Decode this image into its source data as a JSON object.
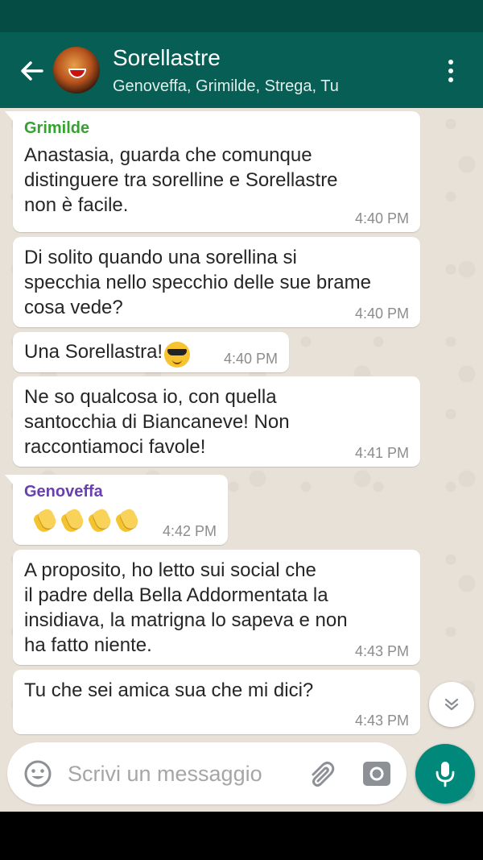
{
  "header": {
    "title": "Sorellastre",
    "subtitle": "Genoveffa, Grimilde, Strega, Tu"
  },
  "messages": [
    {
      "sender": "Grimilde",
      "text": "Anastasia, guarda che comunque\ndistinguere tra sorelline e Sorellastre\nnon è facile.",
      "time": "4:40 PM"
    },
    {
      "text": "Di solito quando una sorellina si\nspecchia nello specchio delle sue brame\ncosa vede?",
      "time": "4:40 PM"
    },
    {
      "text": "Una Sorellastra!",
      "emoji": "smiling-face-with-sunglasses-icon",
      "time": "4:40 PM"
    },
    {
      "text": "Ne so qualcosa io, con quella\nsantocchia di Biancaneve! Non\nraccontiamoci favole!",
      "time": "4:41 PM"
    },
    {
      "sender": "Genoveffa",
      "emoji": "clapping-hands-icon",
      "emoji_count": 4,
      "time": "4:42 PM"
    },
    {
      "text": "A proposito, ho letto sui social che\nil padre della Bella Addormentata la\ninsidiava, la matrigna lo sapeva e non\nha fatto niente.",
      "time": "4:43 PM"
    },
    {
      "text": "Tu che sei amica sua che mi dici?",
      "time": "4:43 PM"
    }
  ],
  "sender_colors": {
    "Grimilde": "#35a12f",
    "Genoveffa": "#6a3fb0"
  },
  "composer": {
    "placeholder": "Scrivi un messaggio"
  },
  "colors": {
    "app_bar": "#075e54",
    "status_bar": "#054d44",
    "accent": "#00897b",
    "chat_background": "#e8e1d8"
  }
}
